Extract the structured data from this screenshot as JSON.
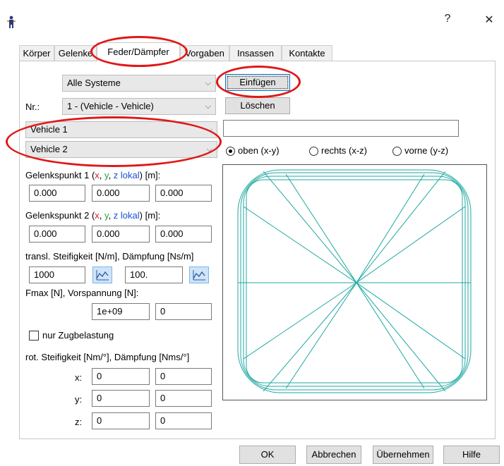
{
  "window": {
    "help_icon": "?",
    "close_icon": "✕"
  },
  "tabs": [
    "Körper",
    "Gelenke",
    "Feder/Dämpfer",
    "Vorgaben",
    "Insassen",
    "Kontakte"
  ],
  "top": {
    "system_select": "Alle Systeme",
    "insert_button": "Einfügen",
    "nr_label": "Nr.:",
    "nr_select": "1 - (Vehicle - Vehicle)",
    "delete_button": "Löschen",
    "vehicle1_select": "Vehicle 1",
    "vehicle2_select": "Vehicle 2",
    "name_field": ""
  },
  "view": {
    "options": [
      "oben (x-y)",
      "rechts (x-z)",
      "vorne (y-z)"
    ],
    "selected": "oben (x-y)"
  },
  "joint1": {
    "label_prefix": "Gelenkspunkt 1 (",
    "x": "x",
    "comma1": ", ",
    "y": "y",
    "comma2": ", ",
    "z": "z lokal",
    "label_suffix": ") [m]:",
    "values": [
      "0.000",
      "0.000",
      "0.000"
    ]
  },
  "joint2": {
    "label_prefix": "Gelenkspunkt 2 (",
    "x": "x",
    "comma1": ", ",
    "y": "y",
    "comma2": ", ",
    "z": "z lokal",
    "label_suffix": ") [m]:",
    "values": [
      "0.000",
      "0.000",
      "0.000"
    ]
  },
  "transl": {
    "label": "transl. Steifigkeit [N/m], Dämpfung [Ns/m]",
    "stiffness": "1000",
    "damping": "100."
  },
  "fmax": {
    "label": "Fmax [N], Vorspannung [N]:",
    "fmax": "1e+09",
    "preload": "0"
  },
  "tension_only": {
    "label": "nur Zugbelastung",
    "checked": false
  },
  "rot": {
    "label": "rot. Steifigkeit [Nm/°], Dämpfung [Nms/°]",
    "rows": [
      {
        "axis": "x:",
        "stiffness": "0",
        "damping": "0"
      },
      {
        "axis": "y:",
        "stiffness": "0",
        "damping": "0"
      },
      {
        "axis": "z:",
        "stiffness": "0",
        "damping": "0"
      }
    ]
  },
  "buttons": {
    "ok": "OK",
    "cancel": "Abbrechen",
    "apply": "Übernehmen",
    "help": "Hilfe"
  },
  "colors": {
    "accent_red": "#e01818",
    "wire": "#1fa8a0",
    "axis_x": "#e01818",
    "axis_y": "#22a030",
    "axis_z": "#1b4fd8"
  }
}
